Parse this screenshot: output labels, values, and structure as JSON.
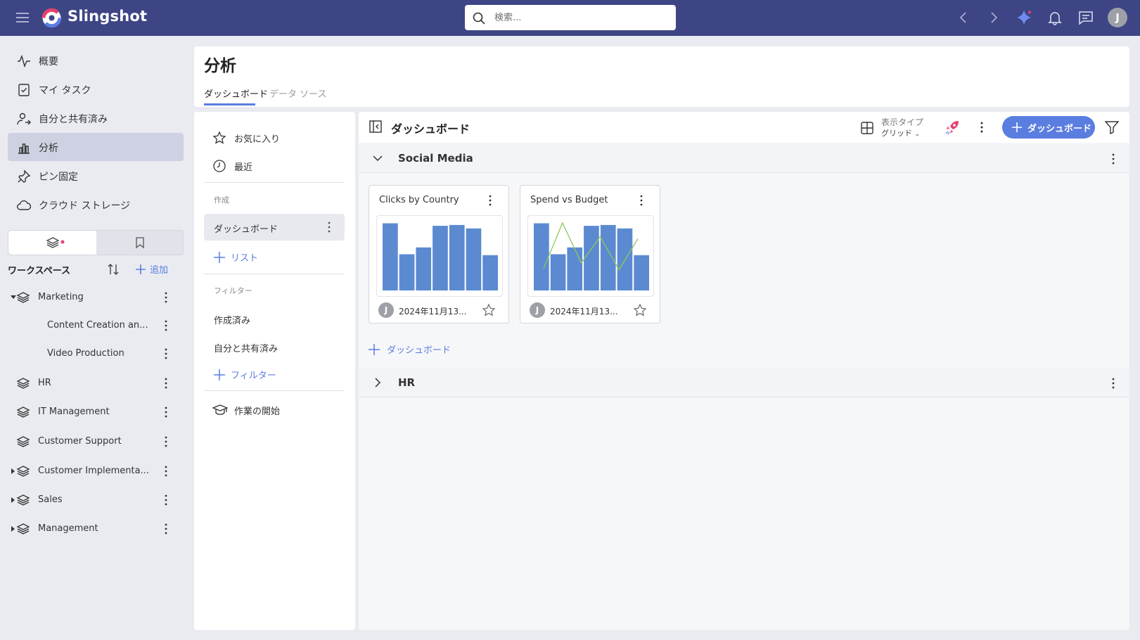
{
  "app": {
    "brand": "Slingshot"
  },
  "search": {
    "placeholder": "検索..."
  },
  "user": {
    "initial": "J"
  },
  "nav": {
    "items": [
      {
        "label": "概要"
      },
      {
        "label": "マイ タスク"
      },
      {
        "label": "自分と共有済み"
      },
      {
        "label": "分析"
      },
      {
        "label": "ピン固定"
      },
      {
        "label": "クラウド ストレージ"
      }
    ]
  },
  "workspaces": {
    "header": "ワークスペース",
    "add_label": "追加",
    "items": [
      {
        "label": "Marketing"
      },
      {
        "label": "Content Creation an..."
      },
      {
        "label": "Video Production"
      },
      {
        "label": "HR"
      },
      {
        "label": "IT Management"
      },
      {
        "label": "Customer Support"
      },
      {
        "label": "Customer Implementa..."
      },
      {
        "label": "Sales"
      },
      {
        "label": "Management"
      }
    ]
  },
  "page": {
    "title": "分析",
    "tabs": [
      {
        "label": "ダッシュボード"
      },
      {
        "label": "データ ソース"
      }
    ]
  },
  "mid": {
    "favorites": "お気に入り",
    "recent": "最近",
    "create_label": "作成",
    "dashboard": "ダッシュボード",
    "list_link": "リスト",
    "filter_label": "フィルター",
    "created": "作成済み",
    "shared": "自分と共有済み",
    "filter_link": "フィルター",
    "getting_started": "作業の開始"
  },
  "main": {
    "title": "ダッシュボード",
    "view_type_label": "表示タイプ",
    "view_type_value": "グリッド",
    "new_dashboard": "ダッシュボード",
    "add_dashboard": "ダッシュボード",
    "groups": [
      {
        "name": "Social Media"
      },
      {
        "name": "HR"
      }
    ],
    "cards": [
      {
        "title": "Clicks by Country",
        "date": "2024年11月13...",
        "initial": "J"
      },
      {
        "title": "Spend vs Budget",
        "date": "2024年11月13...",
        "initial": "J"
      }
    ]
  },
  "chart_data": [
    {
      "type": "bar",
      "title": "Clicks by Country",
      "values": [
        78,
        42,
        50,
        75,
        76,
        72,
        41
      ],
      "ylim": [
        0,
        80
      ]
    },
    {
      "type": "bar",
      "title": "Spend vs Budget",
      "series": [
        {
          "type": "bar",
          "values": [
            78,
            42,
            50,
            75,
            76,
            72,
            41
          ]
        },
        {
          "type": "line",
          "values": [
            32,
            98,
            40,
            78,
            30,
            75
          ]
        }
      ],
      "ylim": [
        0,
        100
      ]
    }
  ],
  "colors": {
    "topbar": "#3d4585",
    "accent": "#5a7de0",
    "bar": "#5b8ad1",
    "line": "#8fc85a",
    "rocket": "#e7406d"
  }
}
